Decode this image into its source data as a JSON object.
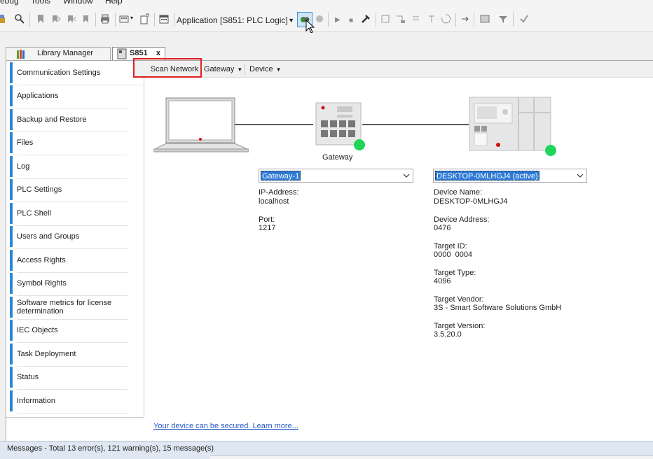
{
  "menu": [
    "ebug",
    "Tools",
    "Window",
    "Help"
  ],
  "toolbar": {
    "application": "Application [S851: PLC Logic]",
    "icons": [
      "device-icon",
      "save-icon",
      "undo-icon",
      "redo-icon",
      "print-icon",
      "add-device-icon",
      "new-object-icon",
      "calendar-icon",
      "login-icon",
      "logout-icon",
      "run-icon",
      "stop-icon",
      "tools-icon",
      "step-icon",
      "breakpoint-icon"
    ]
  },
  "tabs": {
    "library_manager": "Library Manager",
    "device_tab": "S851",
    "close": "x"
  },
  "nav": [
    "Communication Settings",
    "Applications",
    "Backup and Restore",
    "Files",
    "Log",
    "PLC Settings",
    "PLC Shell",
    "Users and Groups",
    "Access Rights",
    "Symbol Rights",
    "Software metrics for license determination",
    "IEC Objects",
    "Task Deployment",
    "Status",
    "Information"
  ],
  "subtoolbar": {
    "scan": "Scan Network",
    "gateway": "Gateway",
    "device": "Device"
  },
  "gateway": {
    "label": "Gateway",
    "selected": "Gateway-1",
    "ip_label": "IP-Address:",
    "ip_value": "localhost",
    "port_label": "Port:",
    "port_value": "1217"
  },
  "device": {
    "selected": "DESKTOP-0MLHGJ4 (active)",
    "name_label": "Device Name:",
    "name_value": "DESKTOP-0MLHGJ4",
    "address_label": "Device Address:",
    "address_value": "0476",
    "target_id_label": "Target ID:",
    "target_id_value": "0000  0004",
    "target_type_label": "Target Type:",
    "target_type_value": "4096",
    "target_vendor_label": "Target Vendor:",
    "target_vendor_value": "3S - Smart Software Solutions GmbH",
    "target_version_label": "Target Version:",
    "target_version_value": "3.5.20.0"
  },
  "secure_link": "Your device can be secured. Learn more...",
  "messages": "Messages - Total 13 error(s), 121 warning(s), 15 message(s)",
  "colors": {
    "accent": "#2a86d6",
    "status_online": "#1fd65a",
    "highlight_box": "#e02020",
    "selection": "#2d7ad6"
  }
}
